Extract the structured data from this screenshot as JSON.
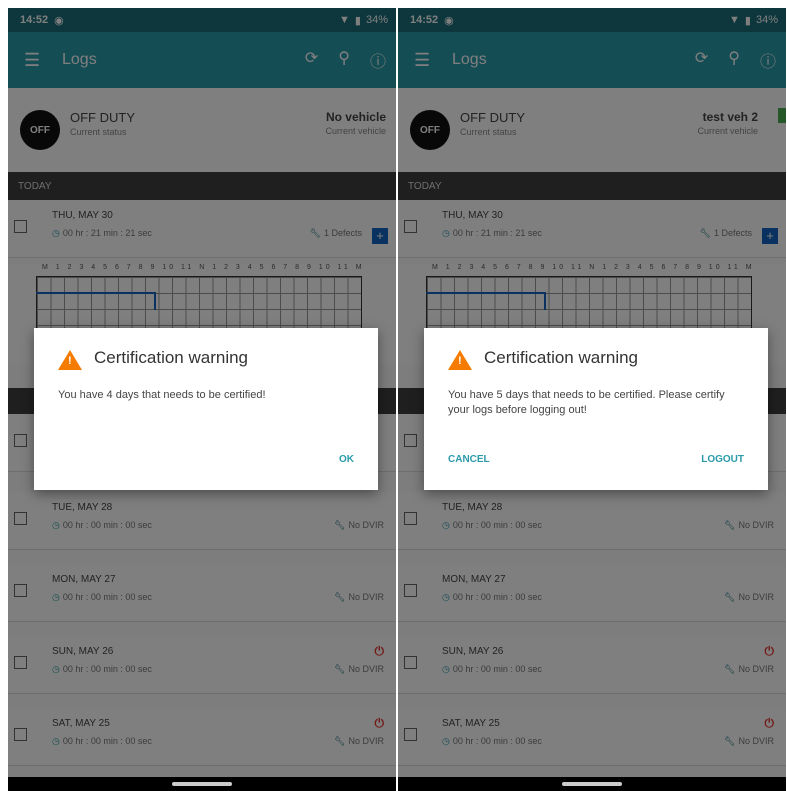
{
  "phones": [
    {
      "status_bar": {
        "time": "14:52",
        "battery": "34%"
      },
      "app_bar": {
        "title": "Logs"
      },
      "duty": {
        "badge": "OFF",
        "title": "OFF DUTY",
        "subtitle": "Current status"
      },
      "vehicle": {
        "title": "No vehicle",
        "subtitle": "Current vehicle"
      },
      "section": "TODAY",
      "top_card": {
        "date": "THU, MAY 30",
        "duration": "00 hr : 21 min : 21 sec",
        "defects": "1 Defects"
      },
      "cards": [
        {
          "date": "TUE, MAY 28",
          "duration": "00 hr : 00 min : 00 sec",
          "defects": "No DVIR"
        },
        {
          "date": "MON, MAY 27",
          "duration": "00 hr : 00 min : 00 sec",
          "defects": "No DVIR"
        },
        {
          "date": "SUN, MAY 26",
          "duration": "00 hr : 00 min : 00 sec",
          "defects": "No DVIR"
        },
        {
          "date": "SAT, MAY 25",
          "duration": "00 hr : 00 min : 00 sec",
          "defects": "No DVIR"
        }
      ],
      "dialog": {
        "title": "Certification warning",
        "message": "You have 4 days that needs to be certified!",
        "ok": "OK"
      }
    },
    {
      "status_bar": {
        "time": "14:52",
        "battery": "34%"
      },
      "app_bar": {
        "title": "Logs"
      },
      "duty": {
        "badge": "OFF",
        "title": "OFF DUTY",
        "subtitle": "Current status"
      },
      "vehicle": {
        "title": "test veh 2",
        "subtitle": "Current vehicle"
      },
      "section": "TODAY",
      "top_card": {
        "date": "THU, MAY 30",
        "duration": "00 hr : 21 min : 21 sec",
        "defects": "1 Defects"
      },
      "cards": [
        {
          "date": "TUE, MAY 28",
          "duration": "00 hr : 00 min : 00 sec",
          "defects": "No DVIR"
        },
        {
          "date": "MON, MAY 27",
          "duration": "00 hr : 00 min : 00 sec",
          "defects": "No DVIR"
        },
        {
          "date": "SUN, MAY 26",
          "duration": "00 hr : 00 min : 00 sec",
          "defects": "No DVIR"
        },
        {
          "date": "SAT, MAY 25",
          "duration": "00 hr : 00 min : 00 sec",
          "defects": "No DVIR"
        }
      ],
      "dialog": {
        "title": "Certification warning",
        "message": "You have 5 days that needs to be certified. Please certify your logs before logging out!",
        "cancel": "CANCEL",
        "logout": "LOGOUT"
      }
    }
  ],
  "icons": {
    "menu": "menu-icon",
    "sync": "sync-icon",
    "location": "location-pin-icon",
    "info": "info-icon",
    "clock": "clock-icon",
    "wrench": "wrench-icon",
    "warning": "warning-triangle-icon",
    "alert": "alert-circle-icon"
  },
  "colors": {
    "primary_dark": "#1a6e79",
    "primary": "#2a9aa9",
    "accent": "#f57c00",
    "error": "#e53935"
  }
}
